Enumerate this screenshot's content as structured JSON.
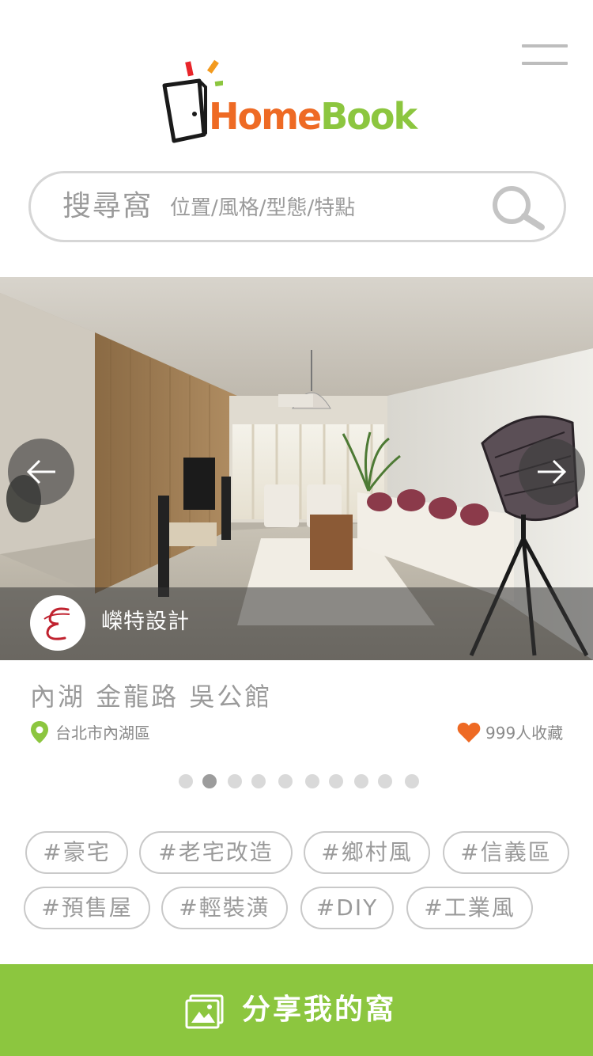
{
  "header": {
    "logo": {
      "part1": "Home",
      "part2": "Book"
    },
    "menu_icon": "hamburger-menu-icon"
  },
  "search": {
    "title": "搜尋窩",
    "placeholder": "位置/風格/型態/特點",
    "icon": "magnifier-icon"
  },
  "carousel": {
    "designer_name": "嶸特設計",
    "prev_icon": "arrow-left-icon",
    "next_icon": "arrow-right-icon",
    "active_index": 1,
    "total_slides": 10
  },
  "case": {
    "title": "內湖 金龍路 吳公館",
    "location": "台北市內湖區",
    "favorites": "999人收藏"
  },
  "tags": [
    "#豪宅",
    "#老宅改造",
    "#鄉村風",
    "#信義區",
    "#預售屋",
    "#輕裝潢",
    "#DIY",
    "#工業風"
  ],
  "share": {
    "label": "分享我的窩",
    "icon": "image-upload-icon"
  },
  "colors": {
    "brand_green": "#8cc63f",
    "brand_orange": "#ee6a24",
    "heart": "#ee6a24",
    "location_pin": "#8cc63f"
  }
}
